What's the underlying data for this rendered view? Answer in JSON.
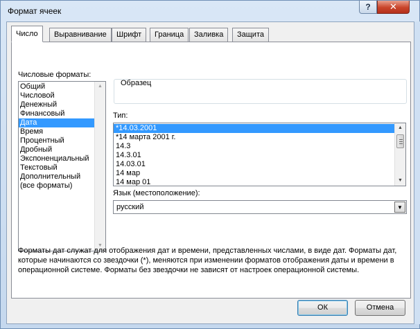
{
  "window": {
    "title": "Формат ячеек",
    "help_label": "?",
    "close_label": "✕"
  },
  "tabs": [
    {
      "label": "Число",
      "active": true
    },
    {
      "label": "Выравнивание"
    },
    {
      "label": "Шрифт"
    },
    {
      "label": "Граница"
    },
    {
      "label": "Заливка"
    },
    {
      "label": "Защита"
    }
  ],
  "category": {
    "label": "Числовые форматы:",
    "items": [
      "Общий",
      "Числовой",
      "Денежный",
      "Финансовый",
      "Дата",
      "Время",
      "Процентный",
      "Дробный",
      "Экспоненциальный",
      "Текстовый",
      "Дополнительный",
      "(все форматы)"
    ],
    "selected": "Дата"
  },
  "sample": {
    "label": "Образец",
    "value": ""
  },
  "type": {
    "label": "Тип:",
    "items": [
      "*14.03.2001",
      "*14 марта 2001 г.",
      "14.3",
      "14.3.01",
      "14.03.01",
      "14 мар",
      "14 мар 01"
    ],
    "selected": "*14.03.2001"
  },
  "locale": {
    "label": "Язык (местоположение):",
    "value": "русский"
  },
  "description": "Форматы дат служат для отображения дат и времени, представленных числами, в виде дат. Форматы дат, которые начинаются со звездочки (*), меняются при изменении форматов отображения даты и времени в операционной системе. Форматы без звездочки не зависят от настроек операционной системы.",
  "buttons": {
    "ok": "ОК",
    "cancel": "Отмена"
  },
  "icons": {
    "help": "help-icon",
    "close": "close-icon",
    "scroll_up": "scroll-up-icon",
    "scroll_down": "scroll-down-icon",
    "dropdown": "chevron-down-icon"
  }
}
